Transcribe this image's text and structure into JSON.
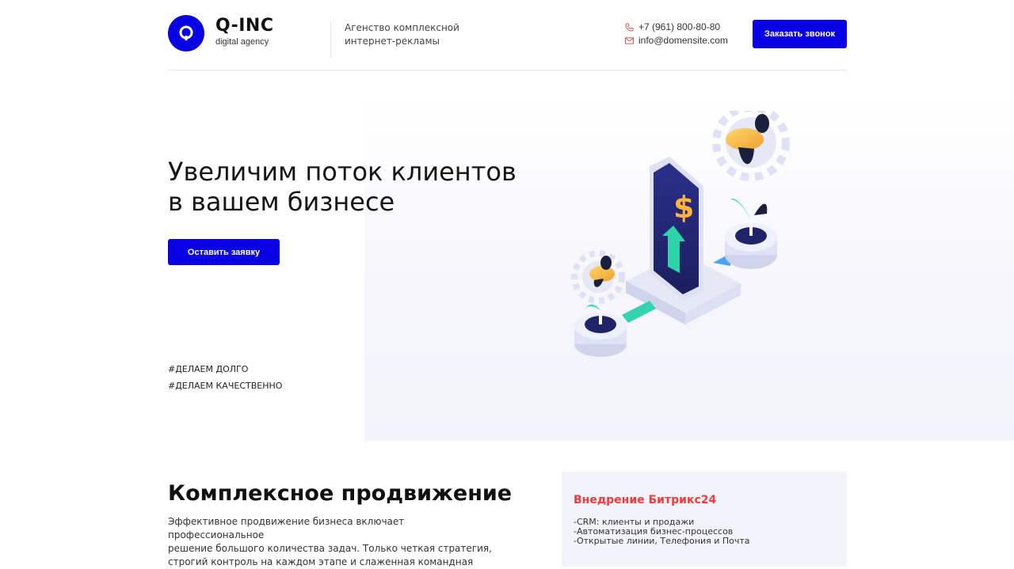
{
  "header": {
    "logo_mark": "Q",
    "logo_name": "Q-INC",
    "logo_sub": "digital agency",
    "tagline_line1": "Агенство комплексной",
    "tagline_line2": "интернет-рекламы",
    "phone": "+7 (961) 800-80-80",
    "email": "info@domensite.com",
    "cta_label": "Заказать звонок"
  },
  "hero": {
    "title_line1": "Увеличим поток клиентов",
    "title_line2": "в вашем бизнесе",
    "button_label": "Оставить заявку",
    "hashtags": [
      "#ДЕЛАЕМ ДОЛГО",
      "#ДЕЛАЕМ КАЧЕСТВЕННО"
    ],
    "illustration_symbol": "$"
  },
  "promo": {
    "title": "Комплексное продвижение",
    "text_lines": [
      "Эффективное продвижение бизнеса включает профессиональное",
      "решение большого количества задач. Только четкая стратегия,",
      "строгий контроль на каждом этапе и слаженная командная"
    ]
  },
  "card": {
    "title": "Внедрение Битрикс24",
    "items": [
      "-CRM: клиенты и продажи",
      "-Автоматизация бизнес-процессов",
      "-Открытые линии, Телефония и Почта"
    ]
  },
  "colors": {
    "accent": "#0a00e6",
    "card_title": "#ee3b3b",
    "card_bg": "#f3f3fb"
  },
  "icons": {
    "phone": "phone-icon",
    "email": "mail-icon"
  }
}
